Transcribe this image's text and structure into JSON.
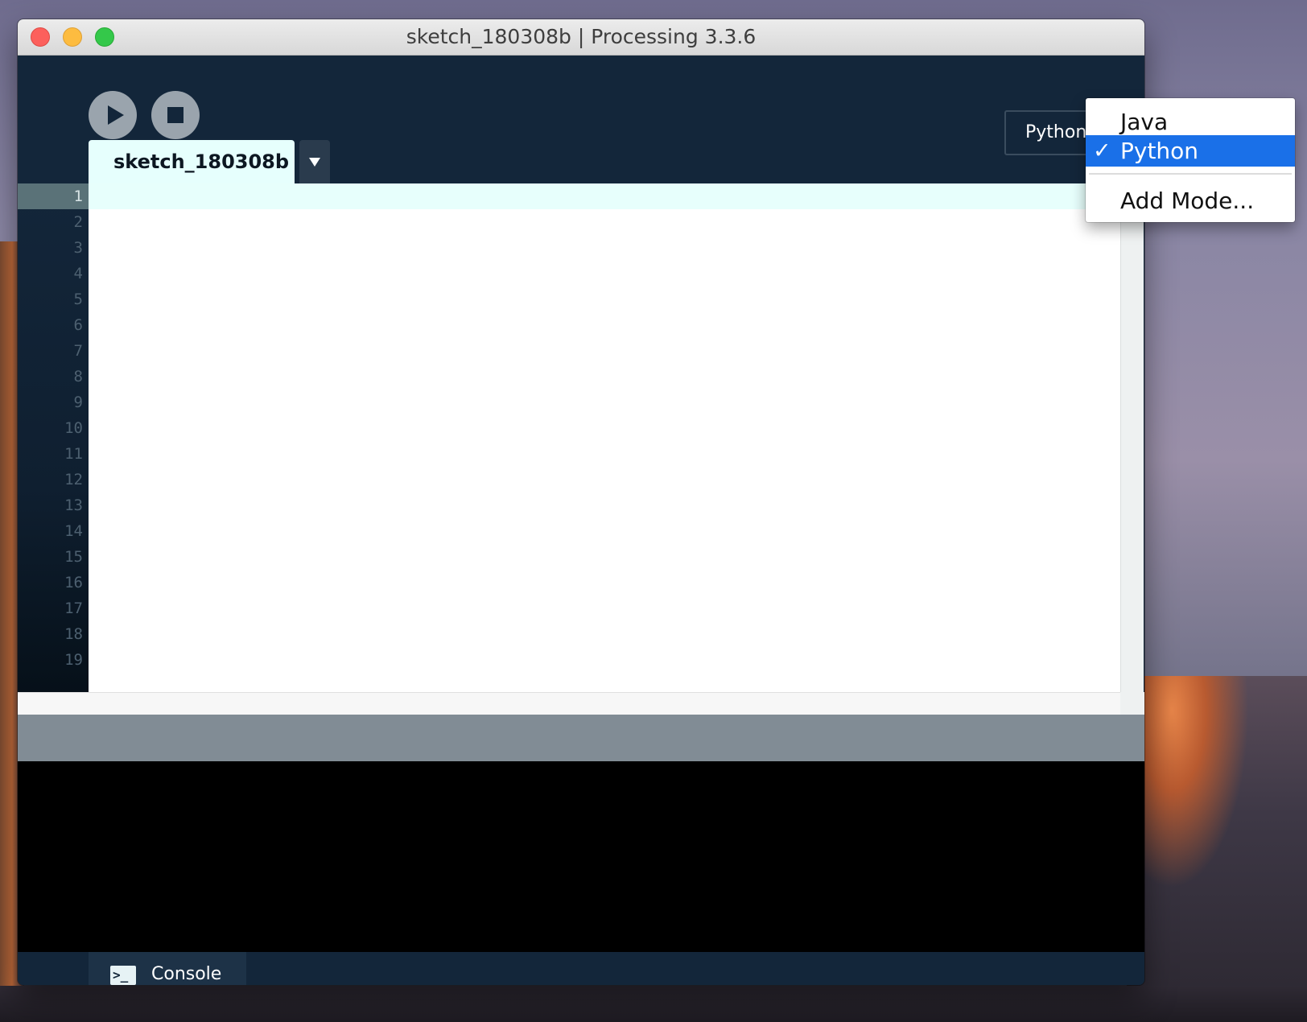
{
  "window": {
    "title": "sketch_180308b | Processing 3.3.6"
  },
  "toolbar": {
    "run_icon": "play-icon",
    "stop_icon": "stop-icon",
    "mode_label": "Python"
  },
  "tabs": [
    {
      "label": "sketch_180308b",
      "active": true
    }
  ],
  "editor": {
    "line_numbers": [
      "1",
      "2",
      "3",
      "4",
      "5",
      "6",
      "7",
      "8",
      "9",
      "10",
      "11",
      "12",
      "13",
      "14",
      "15",
      "16",
      "17",
      "18",
      "19"
    ],
    "current_line": 1,
    "content": ""
  },
  "mode_menu": {
    "items": [
      {
        "label": "Java",
        "checked": false
      },
      {
        "label": "Python",
        "checked": true
      },
      {
        "label": "Add Mode...",
        "checked": false
      }
    ],
    "check_mark": "✓"
  },
  "footer": {
    "console_label": "Console",
    "console_icon_glyph": ">_"
  },
  "colors": {
    "accent": "#1a70e8",
    "toolbar_bg": "#13263a",
    "current_line_bg": "#e7fffc"
  }
}
